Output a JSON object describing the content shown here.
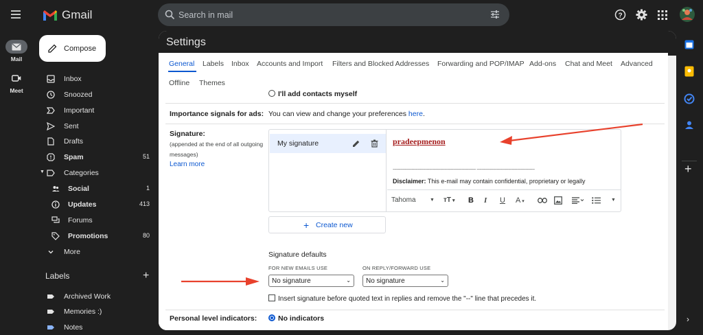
{
  "app": {
    "name": "Gmail"
  },
  "search": {
    "placeholder": "Search in mail"
  },
  "rail": [
    {
      "label": "Mail"
    },
    {
      "label": "Meet"
    }
  ],
  "compose_label": "Compose",
  "nav": [
    {
      "label": "Inbox",
      "count": "",
      "bold": false,
      "icon": "inbox-icon"
    },
    {
      "label": "Snoozed",
      "count": "",
      "bold": false,
      "icon": "clock-icon"
    },
    {
      "label": "Important",
      "count": "",
      "bold": false,
      "icon": "important-icon"
    },
    {
      "label": "Sent",
      "count": "",
      "bold": false,
      "icon": "send-icon"
    },
    {
      "label": "Drafts",
      "count": "",
      "bold": false,
      "icon": "draft-icon"
    },
    {
      "label": "Spam",
      "count": "51",
      "bold": true,
      "icon": "spam-icon"
    },
    {
      "label": "Categories",
      "count": "",
      "bold": false,
      "icon": "label-icon"
    },
    {
      "label": "Social",
      "count": "1",
      "bold": true,
      "icon": "people-icon"
    },
    {
      "label": "Updates",
      "count": "413",
      "bold": true,
      "icon": "info-icon"
    },
    {
      "label": "Forums",
      "count": "",
      "bold": false,
      "icon": "forum-icon"
    },
    {
      "label": "Promotions",
      "count": "80",
      "bold": true,
      "icon": "tag-icon"
    },
    {
      "label": "More",
      "count": "",
      "bold": false,
      "icon": "chevron-down-icon"
    }
  ],
  "labels_header": "Labels",
  "labels": [
    {
      "label": "Archived Work",
      "color": "#e3e3e3"
    },
    {
      "label": "Memories :)",
      "color": "#e3e3e3"
    },
    {
      "label": "Notes",
      "color": "#8ab4f8"
    }
  ],
  "settings": {
    "title": "Settings",
    "tabs": [
      "General",
      "Labels",
      "Inbox",
      "Accounts and Import",
      "Filters and Blocked Addresses",
      "Forwarding and POP/IMAP",
      "Add-ons",
      "Chat and Meet",
      "Advanced",
      "Offline",
      "Themes"
    ],
    "partial_option": "I'll add contacts myself",
    "importance": {
      "label": "Importance signals for ads:",
      "text": "You can view and change your preferences ",
      "link": "here",
      "after": "."
    },
    "signature": {
      "label": "Signature:",
      "sublabel": "(appended at the end of all outgoing messages)",
      "learn_more": "Learn more",
      "item_name": "My signature",
      "sig_text": "pradeepmenon",
      "dashes": "------------------------------------------------------------------  ----------------------------------------------",
      "disclaimer_bold": "Disclaimer:",
      "disclaimer": " This e-mail may contain confidential, proprietary or legally",
      "font": "Tahoma",
      "create_new": "Create new"
    },
    "defaults": {
      "title": "Signature defaults",
      "new_label": "FOR NEW EMAILS USE",
      "new_value": "No signature",
      "reply_label": "ON REPLY/FORWARD USE",
      "reply_value": "No signature",
      "checkbox": "Insert signature before quoted text in replies and remove the \"--\" line that precedes it."
    },
    "personal": {
      "label": "Personal level indicators:",
      "option": "No indicators"
    }
  },
  "colors": {
    "accent": "#0b57d0",
    "arrow": "#e8412c",
    "background": "#1f1f1f"
  }
}
